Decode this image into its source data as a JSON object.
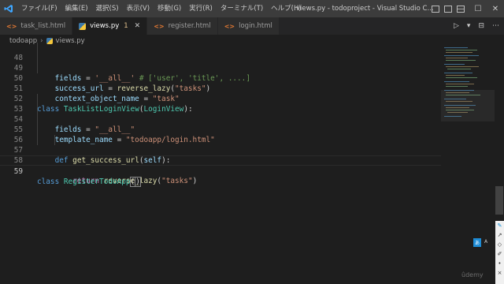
{
  "titlebar": {
    "menu": [
      "ファイル(F)",
      "編集(E)",
      "選択(S)",
      "表示(V)",
      "移動(G)",
      "実行(R)",
      "ターミナル(T)",
      "ヘルプ(H)"
    ],
    "window_title": "views.py - todoproject - Visual Studio C...",
    "min": "—",
    "max": "☐",
    "close": "✕"
  },
  "tabs": [
    {
      "label": "task_list.html",
      "icon": "html-icon",
      "active": false
    },
    {
      "label": "views.py",
      "icon": "python-icon",
      "active": true,
      "modified_count": "1",
      "close": "✕"
    },
    {
      "label": "register.html",
      "icon": "html-icon",
      "active": false
    },
    {
      "label": "login.html",
      "icon": "html-icon",
      "active": false
    }
  ],
  "tab_actions": [
    "▷",
    "▾",
    "⊟",
    "⋯"
  ],
  "breadcrumb": {
    "folder": "todoapp",
    "sep": "›",
    "file": "views.py"
  },
  "editor": {
    "lines": [
      {
        "n": "48",
        "text": "    fields = '__all__' # ['user', 'title', ....]"
      },
      {
        "n": "49",
        "text": "    success_url = reverse_lazy(\"tasks\")"
      },
      {
        "n": "50",
        "text": "    context_object_name = \"task\""
      },
      {
        "n": "51",
        "text": ""
      },
      {
        "n": "52",
        "text": "class TaskListLoginView(LoginView):"
      },
      {
        "n": "53",
        "text": "    fields = \"__all__\""
      },
      {
        "n": "54",
        "text": "    template_name = \"todoapp/login.html\""
      },
      {
        "n": "55",
        "text": ""
      },
      {
        "n": "56",
        "text": "    def get_success_url(self):"
      },
      {
        "n": "57",
        "text": "        return reverse_lazy(\"tasks\")"
      },
      {
        "n": "58",
        "text": ""
      },
      {
        "n": "59",
        "text": "class RegisterTodoApp()"
      }
    ],
    "current_line": "59"
  },
  "side_panel": {
    "badge_left": "あ",
    "badge_right": "A",
    "watermark": "ûdemy"
  },
  "colors": {
    "keyword": "#569cd6",
    "class": "#4ec9b0",
    "function": "#dcdcaa",
    "string": "#ce9178",
    "variable": "#9cdcfe"
  }
}
